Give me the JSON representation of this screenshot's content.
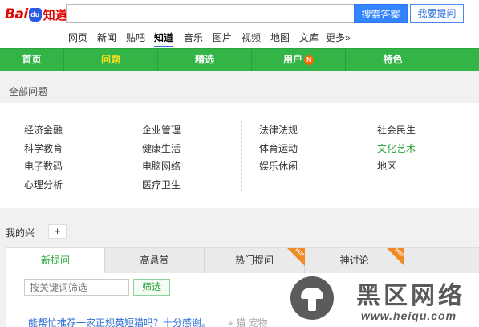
{
  "logo": {
    "bai": "Bai",
    "du": "du",
    "zhidao": "知道"
  },
  "search": {
    "value": "",
    "button_label": "搜索答案",
    "ask_label": "我要提问"
  },
  "channels": [
    "网页",
    "新闻",
    "贴吧",
    "知道",
    "音乐",
    "图片",
    "视频",
    "地图",
    "文库",
    "更多»"
  ],
  "active_channel": "知道",
  "main_nav": [
    {
      "label": "首页"
    },
    {
      "label": "问题"
    },
    {
      "label": "精选"
    },
    {
      "label": "用户",
      "badge": "N"
    },
    {
      "label": "特色"
    }
  ],
  "active_main_nav": "问题",
  "all_questions": {
    "title": "全部问题",
    "columns": [
      [
        "经济金融",
        "科学教育",
        "电子数码",
        "心理分析"
      ],
      [
        "企业管理",
        "健康生活",
        "电脑网络",
        "医疗卫生"
      ],
      [
        "法律法规",
        "体育运动",
        "娱乐休闲"
      ],
      [
        "社会民生",
        "文化艺术",
        "地区"
      ]
    ],
    "highlighted": "文化艺术"
  },
  "interests": {
    "label": "我的兴",
    "add": "+"
  },
  "question_tabs": [
    {
      "label": "新提问"
    },
    {
      "label": "高悬赏"
    },
    {
      "label": "热门提问",
      "hot": "HOT"
    },
    {
      "label": "神讨论",
      "hot": "HOT"
    }
  ],
  "active_question_tab": "新提问",
  "filter": {
    "placeholder": "按关键词筛选",
    "button_label": "筛选"
  },
  "question": {
    "title": "能帮忙推荐一家正规英短猫吗？十分感谢。",
    "tags": "猫   宠物"
  },
  "watermark": {
    "title": "黑区网络",
    "url": "www.heiqu.com"
  },
  "colors": {
    "nav_green": "#32b447",
    "active_yellow": "#ffe11a",
    "link_blue": "#2d6fd6",
    "hot_orange": "#f08a24",
    "logo_red": "#e10602"
  }
}
